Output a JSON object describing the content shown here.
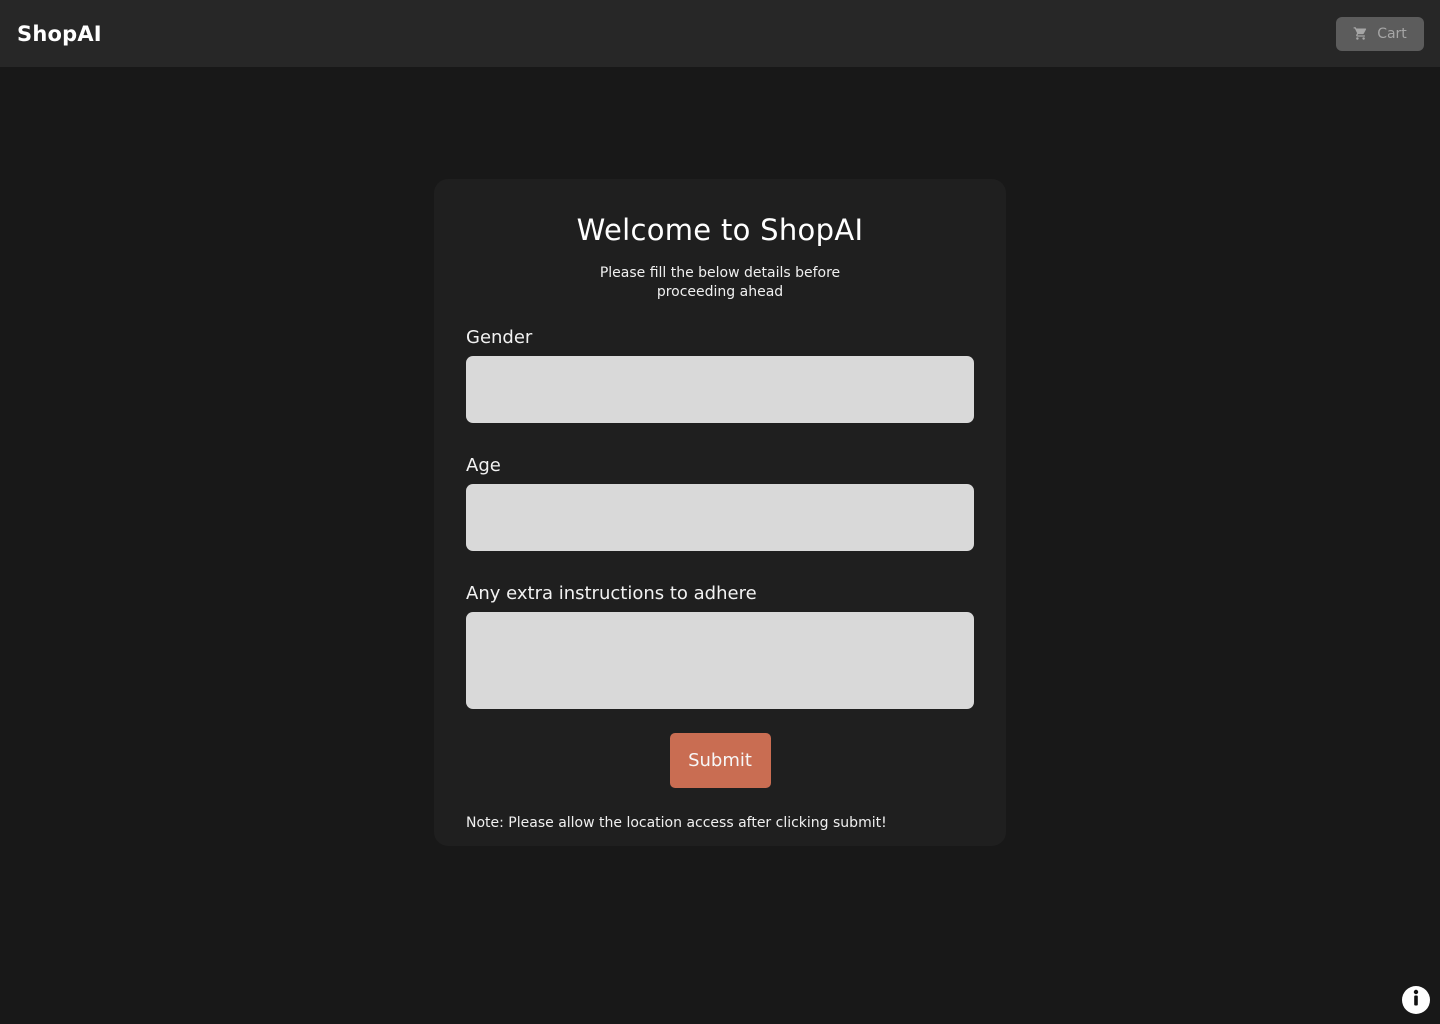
{
  "header": {
    "brand": "ShopAI",
    "cart_label": "Cart",
    "cart_icon": "cart-icon"
  },
  "form": {
    "title": "Welcome to ShopAI",
    "subtitle": "Please fill the below details before proceeding ahead",
    "fields": [
      {
        "label": "Gender",
        "value": "",
        "placeholder": ""
      },
      {
        "label": "Age",
        "value": "",
        "placeholder": ""
      },
      {
        "label": "Any extra instructions to adhere",
        "value": "",
        "placeholder": ""
      }
    ],
    "submit_label": "Submit",
    "note": "Note: Please allow the location access after clicking submit!"
  },
  "footer": {
    "info_icon": "info-icon"
  },
  "colors": {
    "page_background": "#181818",
    "header_background": "#272727",
    "card_background": "#1f1f1f",
    "input_background": "#d9d9d9",
    "accent": "#c96d52",
    "cart_button": "#5c5c5c"
  }
}
